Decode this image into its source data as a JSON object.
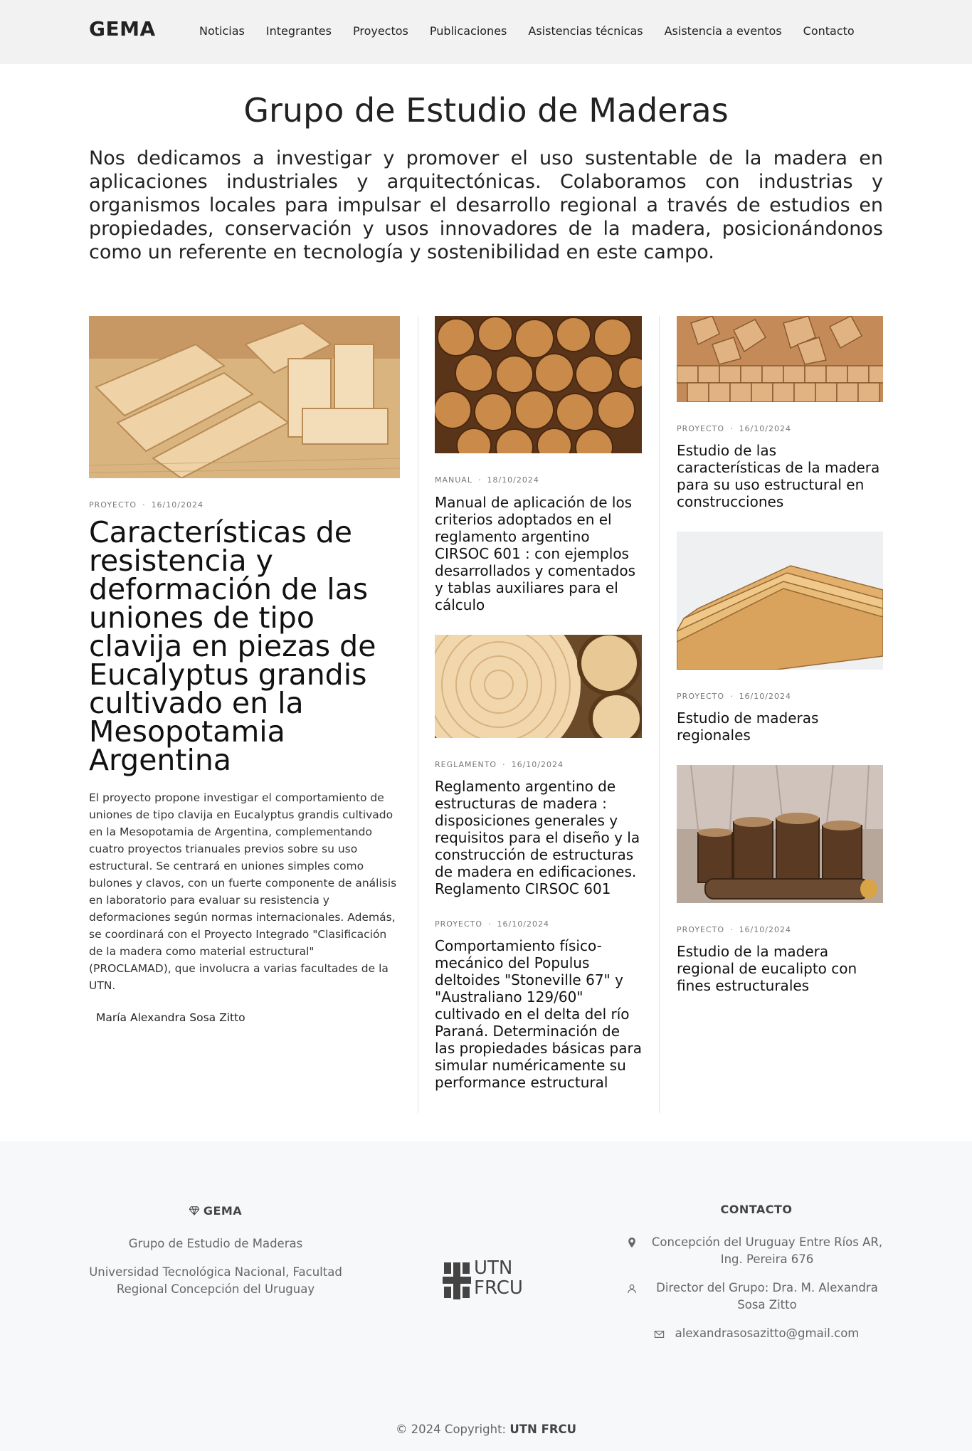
{
  "nav": {
    "brand": "GEMA",
    "items": [
      "Noticias",
      "Integrantes",
      "Proyectos",
      "Publicaciones",
      "Asistencias técnicas",
      "Asistencia a eventos",
      "Contacto"
    ]
  },
  "hero": {
    "title": "Grupo de Estudio de Maderas",
    "description": "Nos dedicamos a investigar y promover el uso sustentable de la madera en aplicaciones industriales y arquitectónicas. Colaboramos con industrias y organismos locales para impulsar el desarrollo regional a través de estudios en propiedades, conservación y usos innovadores de la madera, posicionándonos como un referente en tecnología y sostenibilidad en este campo."
  },
  "featured": {
    "category": "PROYECTO",
    "date": "16/10/2024",
    "title": "Características de resistencia y deformación de las uniones de tipo clavija en piezas de Eucalyptus grandis cultivado en la Mesopotamia Argentina",
    "excerpt": "El proyecto propone investigar el comportamiento de uniones de tipo clavija en Eucalyptus grandis cultivado en la Mesopotamia de Argentina, complementando cuatro proyectos trianuales previos sobre su uso estructural. Se centrará en uniones simples como bulones y clavos, con un fuerte componente de análisis en laboratorio para evaluar su resistencia y deformaciones según normas internacionales. Además, se coordinará con el Proyecto Integrado \"Clasificación de la madera como material estructural\" (PROCLAMAD), que involucra a varias facultades de la UTN.",
    "author": "María Alexandra Sosa Zitto"
  },
  "middle": [
    {
      "category": "MANUAL",
      "date": "18/10/2024",
      "title": "Manual de aplicación de los criterios adoptados en el reglamento argentino CIRSOC 601 : con ejemplos desarrollados y comentados y tablas auxiliares para el cálculo"
    },
    {
      "category": "REGLAMENTO",
      "date": "16/10/2024",
      "title": "Reglamento argentino de estructuras de madera : disposiciones generales y requisitos para el diseño y la construcción de estructuras de madera en edificaciones. Reglamento CIRSOC 601"
    },
    {
      "category": "PROYECTO",
      "date": "16/10/2024",
      "title": "Comportamiento físico-mecánico del Populus deltoides \"Stoneville 67\" y \"Australiano 129/60\" cultivado en el delta del río Paraná. Determinación de las propiedades básicas para simular numéricamente su performance estructural"
    }
  ],
  "right": [
    {
      "category": "PROYECTO",
      "date": "16/10/2024",
      "title": "Estudio de las características de la madera para su uso estructural en construcciones"
    },
    {
      "category": "PROYECTO",
      "date": "16/10/2024",
      "title": "Estudio de maderas regionales"
    },
    {
      "category": "PROYECTO",
      "date": "16/10/2024",
      "title": "Estudio de la madera regional de eucalipto con fines estructurales"
    }
  ],
  "footer": {
    "brand": "GEMA",
    "group_name": "Grupo de Estudio de Maderas",
    "institution": "Universidad Tecnológica Nacional, Facultad Regional Concepción del Uruguay",
    "logo_top": "UTN",
    "logo_bottom": "FRCU",
    "contact_heading": "CONTACTO",
    "address": "Concepción del Uruguay Entre Ríos AR, Ing. Pereira 676",
    "director": "Director del Grupo: Dra. M. Alexandra Sosa Zitto",
    "email": "alexandrasosazitto@gmail.com",
    "copyright_prefix": "© 2024 Copyright:",
    "copyright_owner": "UTN FRCU"
  },
  "icons": {
    "brand_icon": "diamond-icon",
    "address_icon": "map-pin-icon",
    "director_icon": "user-icon",
    "email_icon": "envelope-icon"
  },
  "colors": {
    "nav_bg": "#f2f2f2",
    "footer_bg": "#f7f8fa",
    "wood_light": "#e6c79a",
    "wood_mid": "#c9955a",
    "wood_dark": "#7a4a22"
  }
}
